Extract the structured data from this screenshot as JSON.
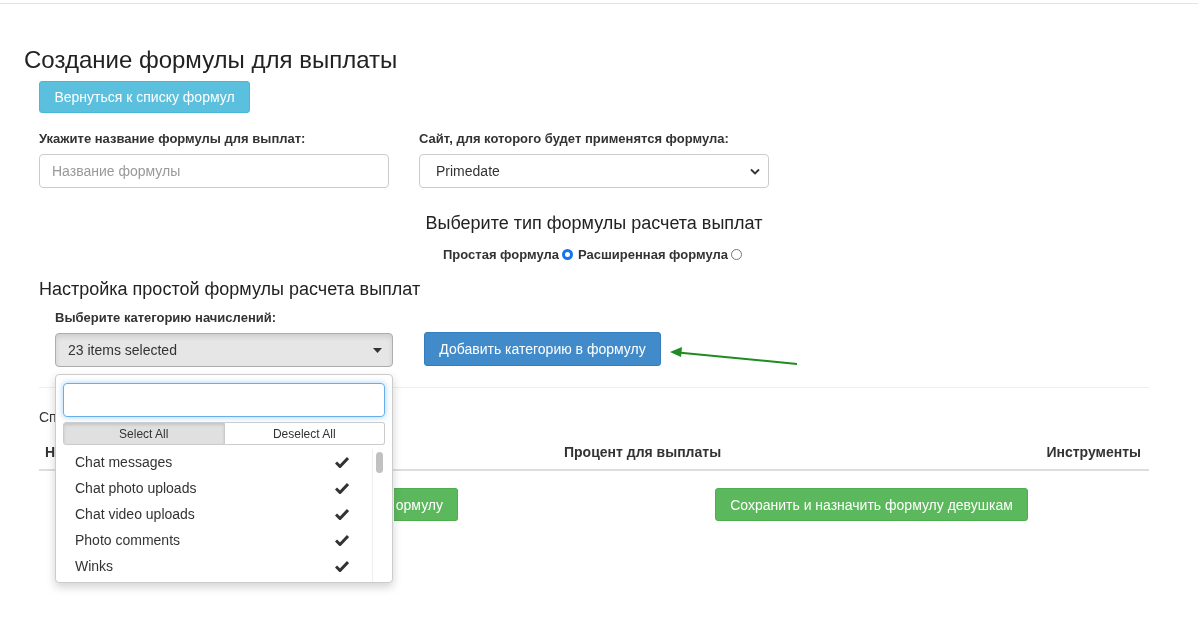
{
  "title": "Создание формулы для выплаты",
  "back_button": "Вернуться к списку формул",
  "name_field": {
    "label": "Укажите название формулы для выплат:",
    "placeholder": "Название формулы"
  },
  "site_field": {
    "label": "Сайт, для которого будет применятся формула:",
    "value": "Primedate"
  },
  "formula_type": {
    "heading": "Выберите тип формулы расчета выплат",
    "options": [
      {
        "label": "Простая формула",
        "selected": true
      },
      {
        "label": "Расширенная формула",
        "selected": false
      }
    ]
  },
  "simple_settings": {
    "heading": "Настройка простой формулы расчета выплат",
    "category_label": "Выберите категорию начислений:",
    "category_select": {
      "value": "23 items selected",
      "expanded": true
    },
    "add_button": "Добавить категорию в формулу"
  },
  "dropdown": {
    "actions": [
      {
        "label": "Select All",
        "active": true
      },
      {
        "label": "Deselect All",
        "active": false
      }
    ],
    "items": [
      {
        "label": "Chat messages",
        "checked": true
      },
      {
        "label": "Chat photo uploads",
        "checked": true
      },
      {
        "label": "Chat video uploads",
        "checked": true
      },
      {
        "label": "Photo comments",
        "checked": true
      },
      {
        "label": "Winks",
        "checked": true
      }
    ]
  },
  "list_heading": "Сп",
  "table": {
    "columns": [
      "Н",
      "Процент для выплаты",
      "Инструменты"
    ]
  },
  "buttons": [
    {
      "label": "ормулу"
    },
    {
      "label": "Сохранить и назначить формулу девушкам"
    }
  ]
}
